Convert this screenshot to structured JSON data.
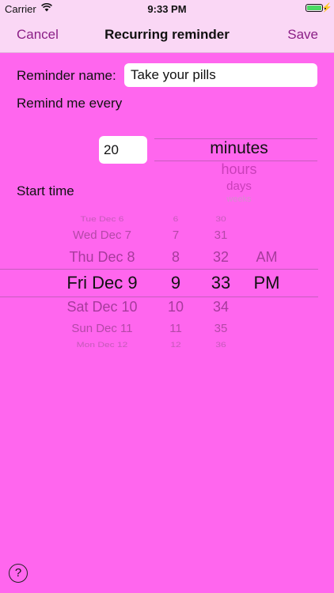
{
  "status_bar": {
    "carrier": "Carrier",
    "time": "9:33 PM"
  },
  "nav": {
    "cancel_label": "Cancel",
    "title": "Recurring reminder",
    "save_label": "Save"
  },
  "form": {
    "name_label": "Reminder name:",
    "name_value": "Take your pills",
    "remind_label": "Remind me every",
    "interval_value": "20",
    "start_label": "Start time"
  },
  "unit_picker": {
    "options": [
      "minutes",
      "hours",
      "days",
      "weeks"
    ],
    "selected": "minutes"
  },
  "date_picker": {
    "dates": [
      "Tue Dec 6",
      "Wed Dec 7",
      "Thu Dec 8",
      "Fri Dec 9",
      "Sat Dec 10",
      "Sun Dec 11",
      "Mon Dec 12"
    ],
    "hours": [
      "6",
      "7",
      "8",
      "9",
      "10",
      "11",
      "12"
    ],
    "minutes": [
      "30",
      "31",
      "32",
      "33",
      "34",
      "35",
      "36"
    ],
    "ampm": [
      "AM",
      "PM"
    ],
    "selected": {
      "date": "Fri Dec 9",
      "hour": "9",
      "minute": "33",
      "ampm": "PM"
    }
  },
  "help": {
    "label": "?"
  },
  "colors": {
    "background": "#ff66ee",
    "nav_background": "#fad7f5",
    "accent": "#8b1f86"
  }
}
